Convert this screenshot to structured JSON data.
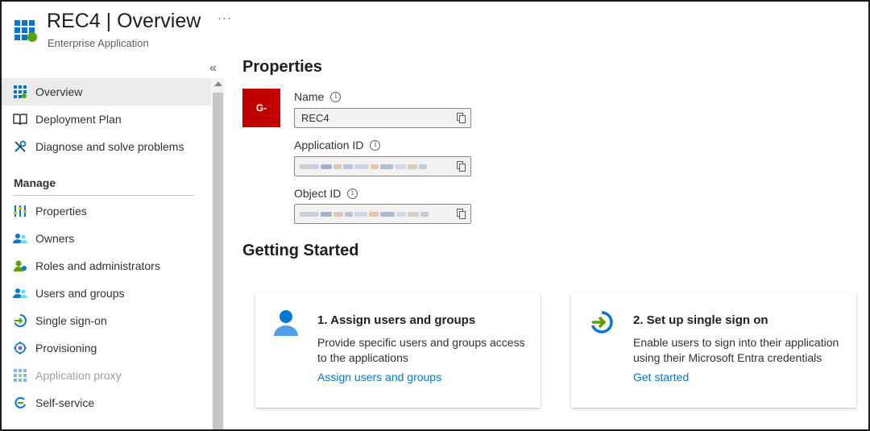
{
  "header": {
    "app_name": "REC4",
    "separator": "|",
    "page_title": "Overview",
    "subtitle": "Enterprise Application",
    "more_label": "···"
  },
  "sidebar": {
    "collapse_label": "«",
    "items_top": [
      {
        "label": "Overview",
        "icon": "grid-icon",
        "active": true
      },
      {
        "label": "Deployment Plan",
        "icon": "book-icon"
      },
      {
        "label": "Diagnose and solve problems",
        "icon": "wrench-icon"
      }
    ],
    "section_manage": "Manage",
    "items_manage": [
      {
        "label": "Properties",
        "icon": "properties-icon"
      },
      {
        "label": "Owners",
        "icon": "owners-icon"
      },
      {
        "label": "Roles and administrators",
        "icon": "roles-icon"
      },
      {
        "label": "Users and groups",
        "icon": "users-icon"
      },
      {
        "label": "Single sign-on",
        "icon": "sso-icon"
      },
      {
        "label": "Provisioning",
        "icon": "provisioning-icon"
      },
      {
        "label": "Application proxy",
        "icon": "proxy-icon",
        "disabled": true
      },
      {
        "label": "Self-service",
        "icon": "self-service-icon"
      }
    ]
  },
  "properties": {
    "heading": "Properties",
    "logo_text": "G-",
    "name_label": "Name",
    "name_value": "REC4",
    "app_id_label": "Application ID",
    "object_id_label": "Object ID"
  },
  "getting_started": {
    "heading": "Getting Started",
    "cards": [
      {
        "title": "1. Assign users and groups",
        "description": "Provide specific users and groups access to the applications",
        "link": "Assign users and groups",
        "icon": "user-icon"
      },
      {
        "title": "2. Set up single sign on",
        "description": "Enable users to sign into their application using their Microsoft Entra credentials",
        "link": "Get started",
        "icon": "sign-in-arrow-icon"
      }
    ]
  },
  "colors": {
    "accent": "#0078d4",
    "logo_bg": "#c00000",
    "active_bg": "#edebe9"
  }
}
